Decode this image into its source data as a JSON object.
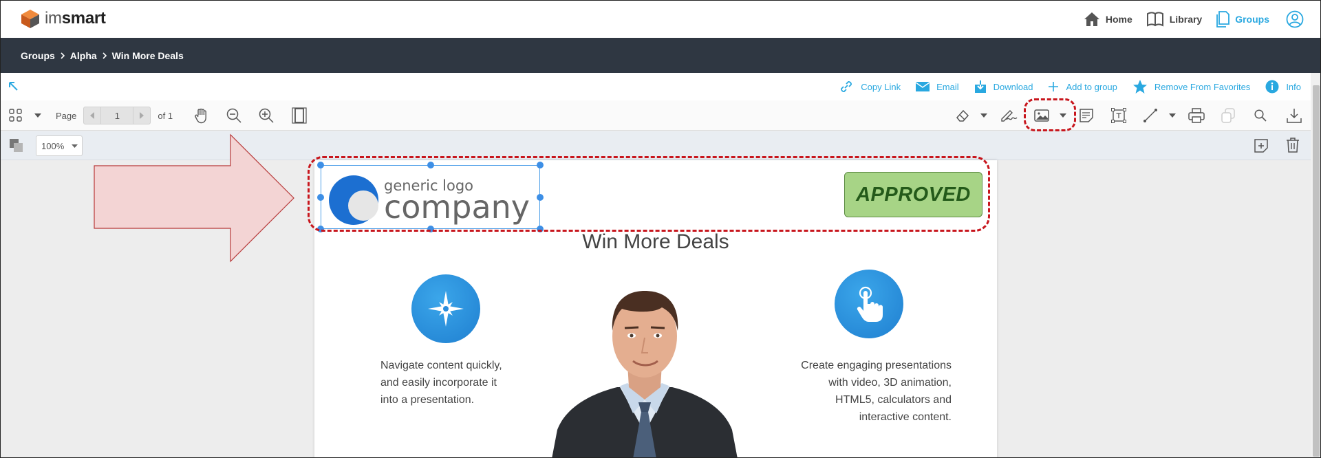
{
  "app": {
    "logo_prefix": "im",
    "logo_suffix": "smart"
  },
  "topnav": {
    "home": "Home",
    "library": "Library",
    "groups": "Groups"
  },
  "breadcrumb": [
    "Groups",
    "Alpha",
    "Win More Deals"
  ],
  "actions": {
    "copy_link": "Copy Link",
    "email": "Email",
    "download": "Download",
    "add_to_group": "Add to group",
    "remove_favorites": "Remove From Favorites",
    "info": "Info"
  },
  "toolbar": {
    "page_label": "Page",
    "page_value": "1",
    "page_of": "of 1",
    "zoom_value": "100%"
  },
  "document": {
    "logo_line1": "generic logo",
    "logo_line2": "company",
    "stamp": "APPROVED",
    "title": "Win More Deals",
    "left_copy": [
      "Navigate content quickly,",
      "and easily incorporate it",
      "into a presentation."
    ],
    "right_copy": [
      "Create engaging presentations",
      "with video, 3D animation,",
      "HTML5, calculators and",
      "interactive content."
    ]
  },
  "colors": {
    "accent": "#29a8e0",
    "header_dark": "#2f3742",
    "highlight_red": "#c8161d",
    "stamp_green": "#a7d486",
    "arrow_fill": "#f3d4d4",
    "selection_blue": "#3d8fe6"
  },
  "icons": [
    "home-icon",
    "library-icon",
    "groups-icon",
    "user-icon",
    "link-icon",
    "email-icon",
    "download-icon",
    "plus-icon",
    "star-icon",
    "info-icon",
    "grid-icon",
    "hand-icon",
    "zoom-out-icon",
    "zoom-in-icon",
    "page-layout-icon",
    "eraser-icon",
    "signature-icon",
    "image-icon",
    "note-icon",
    "textbox-icon",
    "line-icon",
    "print-icon",
    "copy-icon",
    "search-icon",
    "save-icon",
    "layers-icon",
    "sticky-note-icon",
    "trash-icon",
    "compass-icon",
    "touch-icon"
  ]
}
